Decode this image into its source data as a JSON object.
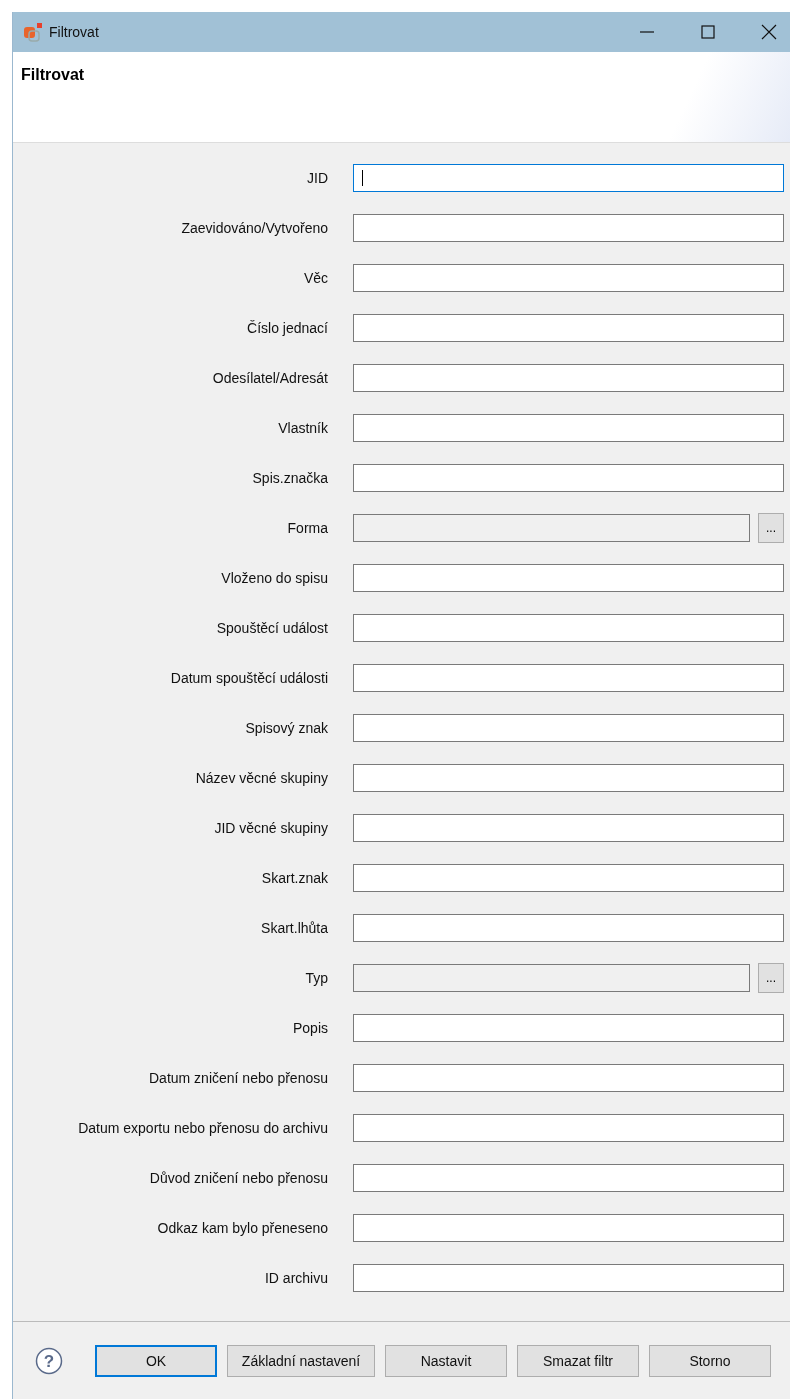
{
  "window": {
    "title": "Filtrovat"
  },
  "header": {
    "title": "Filtrovat"
  },
  "fields": [
    {
      "label": "JID",
      "kind": "text",
      "focused": true
    },
    {
      "label": "Zaevidováno/Vytvořeno",
      "kind": "text",
      "focused": false
    },
    {
      "label": "Věc",
      "kind": "text",
      "focused": false
    },
    {
      "label": "Číslo jednací",
      "kind": "text",
      "focused": false
    },
    {
      "label": "Odesílatel/Adresát",
      "kind": "text",
      "focused": false
    },
    {
      "label": "Vlastník",
      "kind": "text",
      "focused": false
    },
    {
      "label": "Spis.značka",
      "kind": "text",
      "focused": false
    },
    {
      "label": "Forma",
      "kind": "picker",
      "focused": false,
      "button": "..."
    },
    {
      "label": "Vloženo do spisu",
      "kind": "text",
      "focused": false
    },
    {
      "label": "Spouštěcí událost",
      "kind": "text",
      "focused": false
    },
    {
      "label": "Datum spouštěcí události",
      "kind": "text",
      "focused": false
    },
    {
      "label": "Spisový znak",
      "kind": "text",
      "focused": false
    },
    {
      "label": "Název věcné skupiny",
      "kind": "text",
      "focused": false
    },
    {
      "label": "JID věcné skupiny",
      "kind": "text",
      "focused": false
    },
    {
      "label": "Skart.znak",
      "kind": "text",
      "focused": false
    },
    {
      "label": "Skart.lhůta",
      "kind": "text",
      "focused": false
    },
    {
      "label": "Typ",
      "kind": "picker",
      "focused": false,
      "button": "..."
    },
    {
      "label": "Popis",
      "kind": "text",
      "focused": false
    },
    {
      "label": "Datum zničení nebo přenosu",
      "kind": "text",
      "focused": false
    },
    {
      "label": "Datum exportu nebo přenosu do archivu",
      "kind": "text",
      "focused": false
    },
    {
      "label": "Důvod zničení nebo přenosu",
      "kind": "text",
      "focused": false
    },
    {
      "label": "Odkaz kam bylo přeneseno",
      "kind": "text",
      "focused": false
    },
    {
      "label": "ID archivu",
      "kind": "text",
      "focused": false
    }
  ],
  "footer": {
    "help": "?",
    "buttons": [
      {
        "label": "OK",
        "default": true
      },
      {
        "label": "Základní nastavení",
        "default": false
      },
      {
        "label": "Nastavit",
        "default": false
      },
      {
        "label": "Smazat filtr",
        "default": false
      },
      {
        "label": "Storno",
        "default": false
      }
    ]
  }
}
